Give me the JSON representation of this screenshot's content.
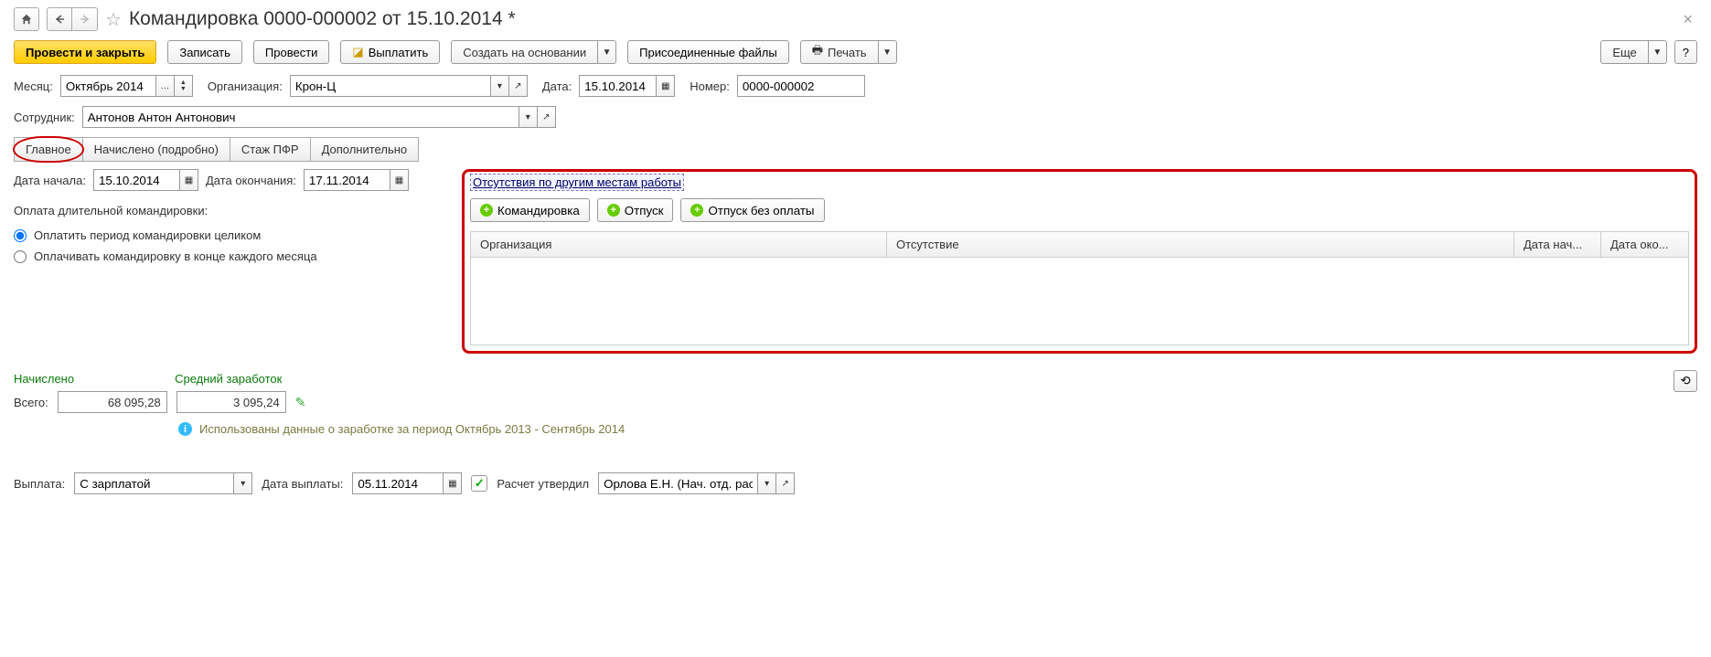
{
  "title": "Командировка 0000-000002 от 15.10.2014 *",
  "toolbar": {
    "post_close": "Провести и закрыть",
    "save": "Записать",
    "post": "Провести",
    "pay": "Выплатить",
    "create_based": "Создать на основании",
    "attachments": "Присоединенные файлы",
    "print": "Печать",
    "more": "Еще",
    "help": "?"
  },
  "header": {
    "month_label": "Месяц:",
    "month": "Октябрь 2014",
    "org_label": "Организация:",
    "org": "Крон-Ц",
    "date_label": "Дата:",
    "date": "15.10.2014",
    "number_label": "Номер:",
    "number": "0000-000002",
    "employee_label": "Сотрудник:",
    "employee": "Антонов Антон Антонович"
  },
  "tabs": {
    "main": "Главное",
    "accrued": "Начислено (подробно)",
    "pension": "Стаж ПФР",
    "extra": "Дополнительно"
  },
  "main_tab": {
    "start_label": "Дата начала:",
    "start": "15.10.2014",
    "end_label": "Дата окончания:",
    "end": "17.11.2014",
    "long_trip_label": "Оплата длительной командировки:",
    "radio1": "Оплатить период командировки целиком",
    "radio2": "Оплачивать командировку в конце каждого месяца"
  },
  "other_abs": {
    "title": "Отсутствия по другим местам работы",
    "btn_trip": "Командировка",
    "btn_vacation": "Отпуск",
    "btn_unpaid": "Отпуск без оплаты",
    "col_org": "Организация",
    "col_abs": "Отсутствие",
    "col_start": "Дата нач...",
    "col_end": "Дата око..."
  },
  "totals": {
    "accrued_label": "Начислено",
    "avg_label": "Средний заработок",
    "total_label": "Всего:",
    "total_value": "68 095,28",
    "avg_value": "3 095,24",
    "info": "Использованы данные о заработке за период Октябрь 2013 - Сентябрь 2014"
  },
  "bottom": {
    "payout_label": "Выплата:",
    "payout_value": "С зарплатой",
    "payout_date_label": "Дата выплаты:",
    "payout_date": "05.11.2014",
    "approved_label": "Расчет утвердил",
    "approver": "Орлова Е.Н. (Нач. отд. расч"
  }
}
